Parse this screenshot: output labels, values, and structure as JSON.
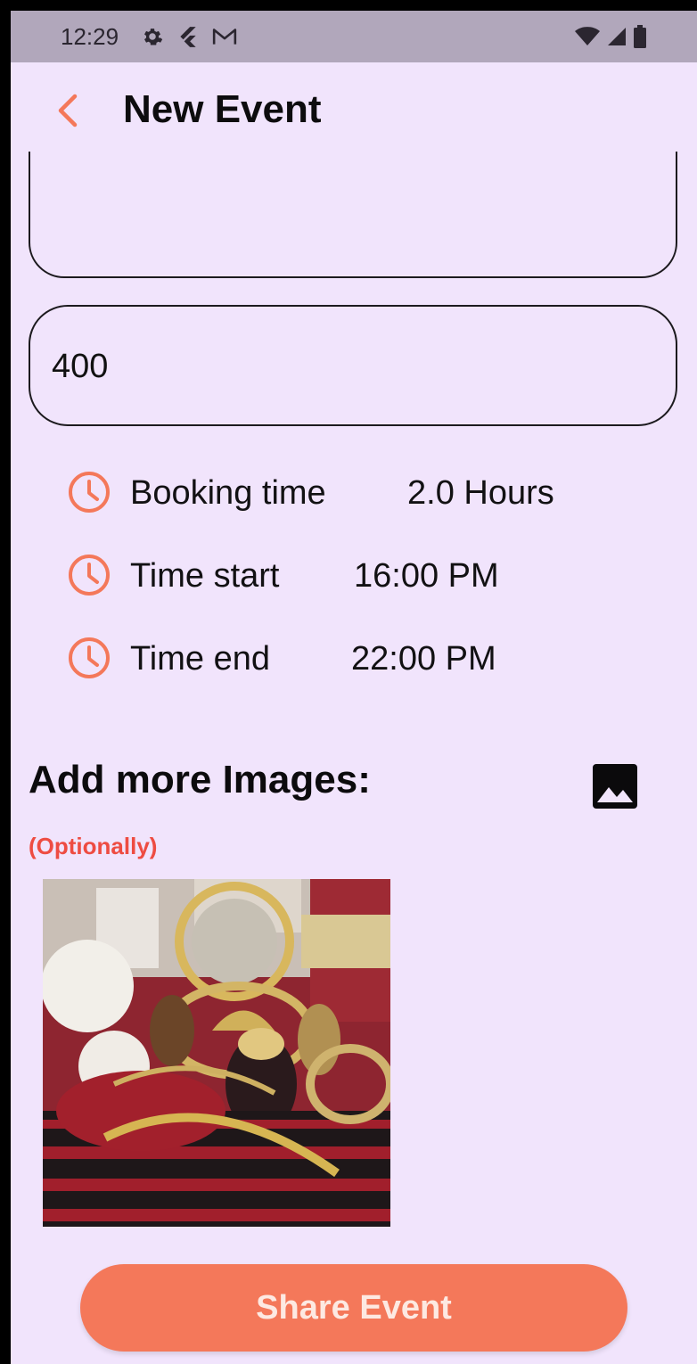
{
  "status_bar": {
    "time": "12:29",
    "left_icons": [
      "settings-icon",
      "flutter-icon",
      "gmail-icon"
    ],
    "right_icons": [
      "wifi-icon",
      "signal-icon",
      "battery-icon"
    ]
  },
  "app_bar": {
    "title": "New Event",
    "back_icon": "chevron-left-icon"
  },
  "form": {
    "description_value": "",
    "price_value": "400"
  },
  "times": [
    {
      "label": "Booking time",
      "value": "2.0 Hours",
      "icon": "clock-icon"
    },
    {
      "label": "Time start",
      "value": "16:00 PM",
      "icon": "clock-icon"
    },
    {
      "label": "Time end",
      "value": "22:00 PM",
      "icon": "clock-icon"
    }
  ],
  "images_section": {
    "title": "Add more Images:",
    "note": "(Optionally)",
    "add_icon": "image-icon"
  },
  "actions": {
    "share_label": "Share Event"
  },
  "colors": {
    "accent": "#f4785a",
    "background": "#f1e4fc",
    "status_bar": "#b1a7bb",
    "optional_note": "#ee4c42"
  }
}
